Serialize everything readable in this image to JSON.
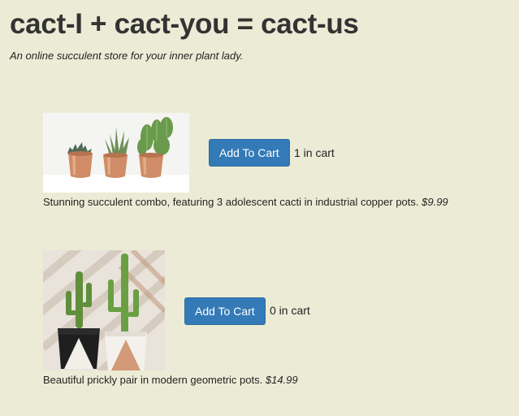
{
  "header": {
    "title": "cact-I + cact-you = cact-us",
    "tagline": "An online succulent store for your inner plant lady."
  },
  "products": [
    {
      "image_icon": "three-succulents-copper-pots-image",
      "add_label": "Add To Cart",
      "cart_count": "1 in cart",
      "description": "Stunning succulent combo, featuring 3 adolescent cacti in industrial copper pots.",
      "price": "$9.99"
    },
    {
      "image_icon": "two-cacti-geometric-pots-image",
      "add_label": "Add To Cart",
      "cart_count": "0 in cart",
      "description": "Beautiful prickly pair in modern geometric pots.",
      "price": "$14.99"
    }
  ],
  "colors": {
    "background": "#ececd6",
    "button": "#337ab7",
    "copper": "#c98a63"
  }
}
